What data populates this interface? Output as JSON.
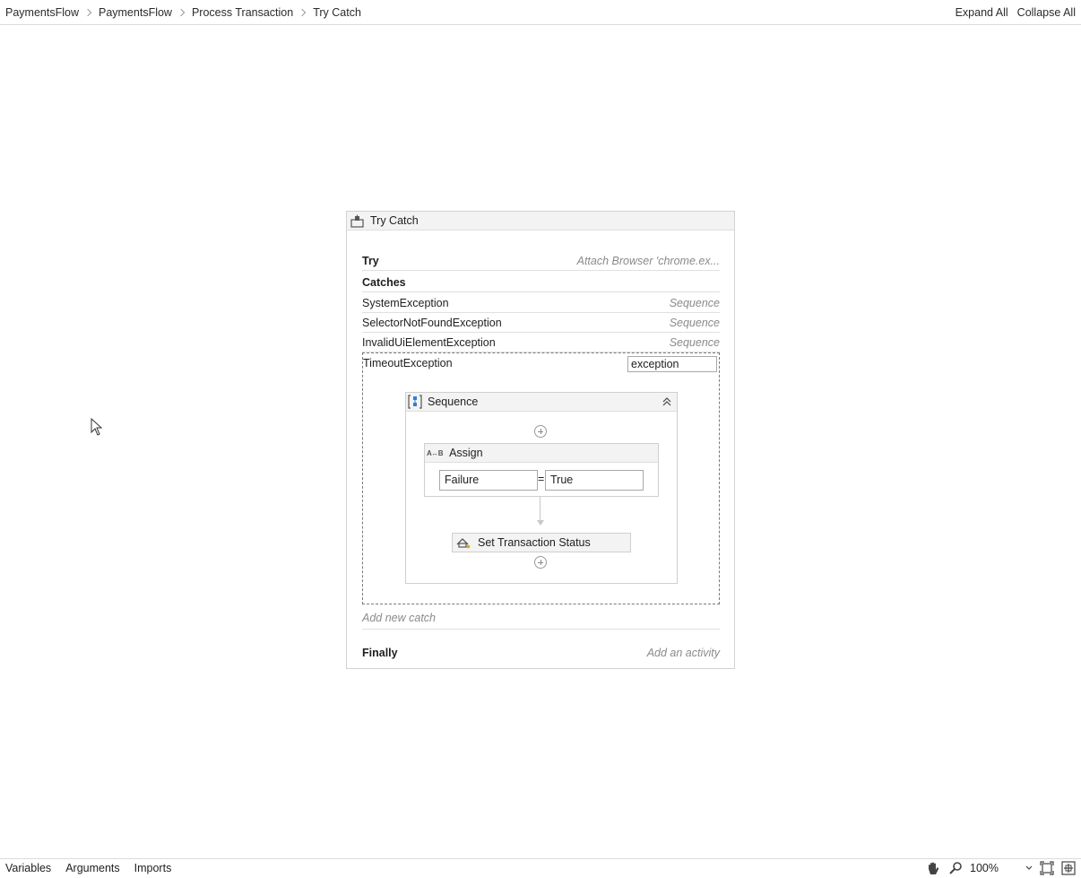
{
  "breadcrumb": [
    "PaymentsFlow",
    "PaymentsFlow",
    "Process Transaction",
    "Try Catch"
  ],
  "top_actions": {
    "expand_all": "Expand All",
    "collapse_all": "Collapse All"
  },
  "try_catch": {
    "title": "Try Catch",
    "try_label": "Try",
    "try_activity": "Attach Browser 'chrome.ex...",
    "catches_label": "Catches",
    "catches": [
      {
        "exception": "SystemException",
        "handler": "Sequence"
      },
      {
        "exception": "SelectorNotFoundException",
        "handler": "Sequence"
      },
      {
        "exception": "InvalidUiElementException",
        "handler": "Sequence"
      }
    ],
    "expanded_catch": {
      "exception": "TimeoutException",
      "variable": "exception",
      "sequence": {
        "title": "Sequence",
        "assign": {
          "title": "Assign",
          "to": "Failure",
          "value": "True",
          "operator": "="
        },
        "set_status": {
          "title": "Set Transaction Status"
        }
      }
    },
    "add_catch": "Add new catch",
    "finally_label": "Finally",
    "finally_activity": "Add an activity"
  },
  "bottom": {
    "tabs": [
      "Variables",
      "Arguments",
      "Imports"
    ],
    "zoom": "100%"
  },
  "icons": [
    "hand-icon",
    "search-icon",
    "fit-screen-icon",
    "overview-icon",
    "pointer-cursor-icon"
  ]
}
